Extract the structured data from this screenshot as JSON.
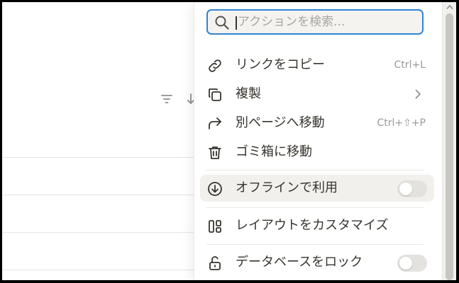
{
  "search": {
    "placeholder": "アクションを検索..."
  },
  "menu": {
    "items": [
      {
        "label": "リンクをコピー",
        "shortcut": "Ctrl+L",
        "icon": "link-icon"
      },
      {
        "label": "複製",
        "icon": "duplicate-icon",
        "submenu": true
      },
      {
        "label": "別ページへ移動",
        "shortcut": "Ctrl+⇧+P",
        "icon": "move-to-icon"
      },
      {
        "label": "ゴミ箱に移動",
        "icon": "trash-icon"
      },
      {
        "label": "オフラインで利用",
        "icon": "download-circle-icon",
        "toggle": false
      },
      {
        "label": "レイアウトをカスタマイズ",
        "icon": "layout-icon"
      },
      {
        "label": "データベースをロック",
        "icon": "lock-icon",
        "toggle": false
      }
    ]
  },
  "background": {
    "icons": [
      "filter-icon",
      "sort-icon"
    ]
  },
  "colors": {
    "accent": "#2f84d4",
    "text": "#37352f",
    "muted": "#9b9a97",
    "hover": "#f1f0ed"
  }
}
